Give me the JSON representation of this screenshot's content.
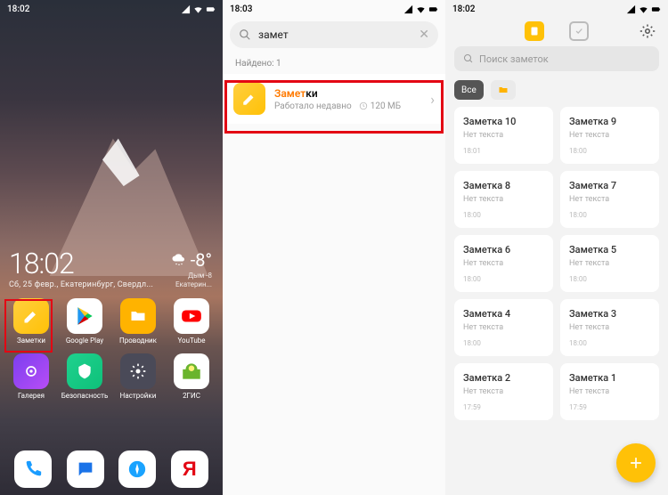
{
  "panel1": {
    "time": "18:02",
    "clock": "18:02",
    "date": "Сб, 25 февр., Екатеринбург, Свердл...",
    "temp": "-8°",
    "wsub1": "Дым -8",
    "wsub2": "Екатерин...",
    "apps": [
      {
        "label": "Заметки",
        "cls": "ic-notes"
      },
      {
        "label": "Google Play",
        "cls": "ic-play"
      },
      {
        "label": "Проводник",
        "cls": "ic-files"
      },
      {
        "label": "YouTube",
        "cls": "ic-yt"
      },
      {
        "label": "Галерея",
        "cls": "ic-gallery"
      },
      {
        "label": "Безопасность",
        "cls": "ic-sec"
      },
      {
        "label": "Настройки",
        "cls": "ic-settings"
      },
      {
        "label": "2ГИС",
        "cls": "ic-2gis"
      }
    ]
  },
  "panel2": {
    "time": "18:03",
    "query": "замет",
    "found": "Найдено: 1",
    "match": "Замет",
    "rest": "ки",
    "sub1": "Работало недавно",
    "sub2": "120 МБ"
  },
  "panel3": {
    "time": "18:02",
    "search_ph": "Поиск заметок",
    "all": "Все",
    "notes": [
      {
        "t": "Заметка 10",
        "s": "Нет текста",
        "tm": "18:01"
      },
      {
        "t": "Заметка 9",
        "s": "Нет текста",
        "tm": "18:00"
      },
      {
        "t": "Заметка 8",
        "s": "Нет текста",
        "tm": "18:00"
      },
      {
        "t": "Заметка 7",
        "s": "Нет текста",
        "tm": "18:00"
      },
      {
        "t": "Заметка 6",
        "s": "Нет текста",
        "tm": "18:00"
      },
      {
        "t": "Заметка 5",
        "s": "Нет текста",
        "tm": "18:00"
      },
      {
        "t": "Заметка 4",
        "s": "Нет текста",
        "tm": "18:00"
      },
      {
        "t": "Заметка 3",
        "s": "Нет текста",
        "tm": "18:00"
      },
      {
        "t": "Заметка 2",
        "s": "Нет текста",
        "tm": "17:59"
      },
      {
        "t": "Заметка 1",
        "s": "Нет текста",
        "tm": "17:59"
      }
    ]
  }
}
